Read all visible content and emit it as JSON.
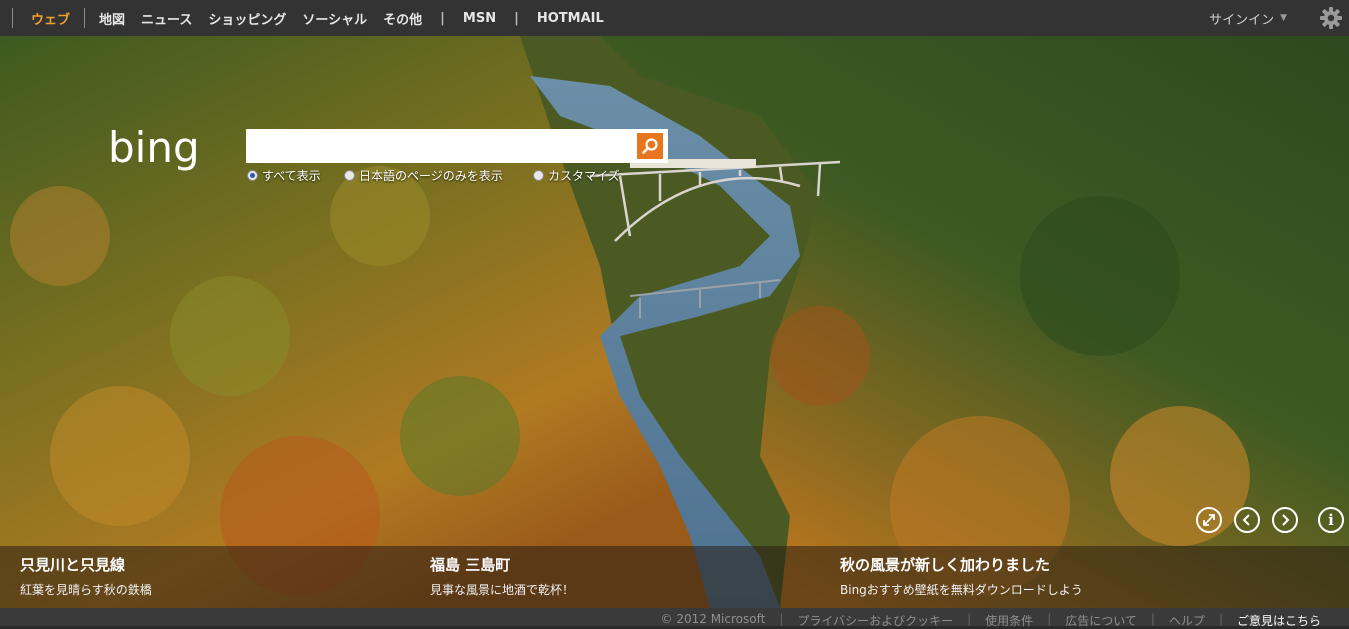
{
  "nav": {
    "items": [
      "ウェブ",
      "地図",
      "ニュース",
      "ショッピング",
      "ソーシャル",
      "その他"
    ],
    "extra": [
      "MSN",
      "HOTMAIL"
    ],
    "signin": "サインイン",
    "accent": "#f0a030"
  },
  "search": {
    "logo": "bing",
    "value": "",
    "options": [
      "すべて表示",
      "日本語のページのみを表示",
      "カスタマイズ"
    ],
    "selected_option": "すべて表示",
    "button_icon": "search-icon"
  },
  "controls": [
    "expand-icon",
    "previous-icon",
    "next-icon",
    "info-icon"
  ],
  "captions": [
    {
      "title": "只見川と只見線",
      "subtitle": "紅葉を見晴らす秋の鉄橋"
    },
    {
      "title": "福島 三島町",
      "subtitle": "見事な風景に地酒で乾杯！"
    },
    {
      "title": "秋の風景が新しく加わりました",
      "subtitle": "Bingおすすめ壁紙を無料ダウンロードしよう"
    }
  ],
  "footer": {
    "copyright": "© 2012 Microsoft",
    "links": [
      "プライバシーおよびクッキー",
      "使用条件",
      "広告について",
      "ヘルプ",
      "ご意見はこちら"
    ]
  }
}
